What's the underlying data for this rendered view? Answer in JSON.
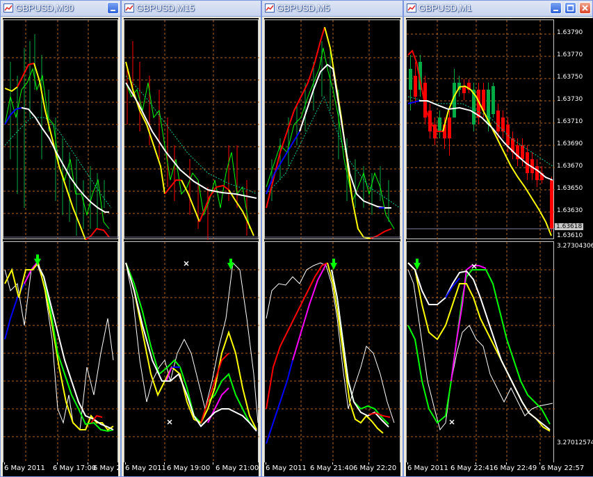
{
  "windows": [
    {
      "title": "GBPUSD,M30",
      "time_labels": [
        "6 May 2011",
        "6 May 17:00",
        "6 May 2"
      ],
      "price_labels": [],
      "current_price": ""
    },
    {
      "title": "GBPUSD,M15",
      "time_labels": [
        "6 May 2011",
        "6 May 19:00",
        "6 May 21:00"
      ],
      "price_labels": [],
      "current_price": ""
    },
    {
      "title": "GBPUSD,M5",
      "time_labels": [
        "6 May 2011",
        "6 May 21:40",
        "6 May 22:20"
      ],
      "price_labels": [],
      "current_price": ""
    },
    {
      "title": "GBPUSD,M1",
      "time_labels": [
        "6 May 2011",
        "6 May 22:41",
        "6 May 22:49",
        "6 May 22:57"
      ],
      "price_labels": [
        "1.63790",
        "1.63770",
        "1.63750",
        "1.63730",
        "1.63710",
        "1.63690",
        "1.63670",
        "1.63650",
        "1.63630",
        "1.63610"
      ],
      "current_price": "1.63618",
      "indicator_labels": [
        "3.27304306",
        "3.27012574"
      ]
    }
  ],
  "window_buttons": {
    "minimize": "minimize",
    "maximize": "maximize",
    "close": "close"
  },
  "colors": {
    "grid": "#b4641e",
    "up_trend": "#ff0000",
    "down_trend": "#ffff00",
    "blue_segment": "#0000ff",
    "white_line": "#ffffff",
    "green_line": "#00ff00",
    "magenta_line": "#ff00ff",
    "bull_candle": "#00aa44",
    "bear_candle": "#ff0000"
  },
  "icons": [
    "chart-window-icon",
    "minimize-icon",
    "maximize-icon",
    "close-icon",
    "arrow-down-icon",
    "cross-marker-icon"
  ]
}
